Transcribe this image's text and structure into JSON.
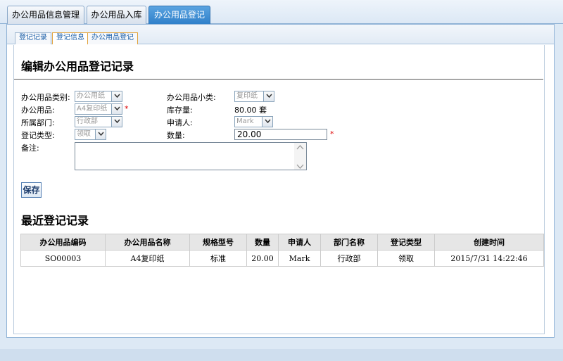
{
  "top_tabs": [
    "办公用品信息管理",
    "办公用品入库",
    "办公用品登记"
  ],
  "sub_tabs": [
    "登记记录",
    "登记信息",
    "办公用品登记"
  ],
  "form": {
    "title": "编辑办公用品登记记录",
    "category_label": "办公用品类别:",
    "category_value": "办公用纸",
    "subcategory_label": "办公用品小类:",
    "subcategory_value": "复印纸",
    "item_label": "办公用品:",
    "item_value": "A4复印纸",
    "stock_label": "库存量:",
    "stock_value": "80.00 套",
    "dept_label": "所属部门:",
    "dept_value": "行政部",
    "applicant_label": "申请人:",
    "applicant_value": "Mark",
    "type_label": "登记类型:",
    "type_value": "领取",
    "qty_label": "数量:",
    "qty_value": "20.00",
    "note_label": "备注:",
    "required_mark": "*",
    "save_label": "保存"
  },
  "recent": {
    "title": "最近登记记录",
    "headers": [
      "办公用品编码",
      "办公用品名称",
      "规格型号",
      "数量",
      "申请人",
      "部门名称",
      "登记类型",
      "创建时间"
    ],
    "rows": [
      [
        "SO00003",
        "A4复印纸",
        "标准",
        "20.00",
        "Mark",
        "行政部",
        "领取",
        "2015/7/31 14:22:46"
      ]
    ]
  },
  "colors": {
    "active_tab": "#2e7fc9",
    "page_bg": "#dde9f5",
    "required": "#dd0000"
  }
}
